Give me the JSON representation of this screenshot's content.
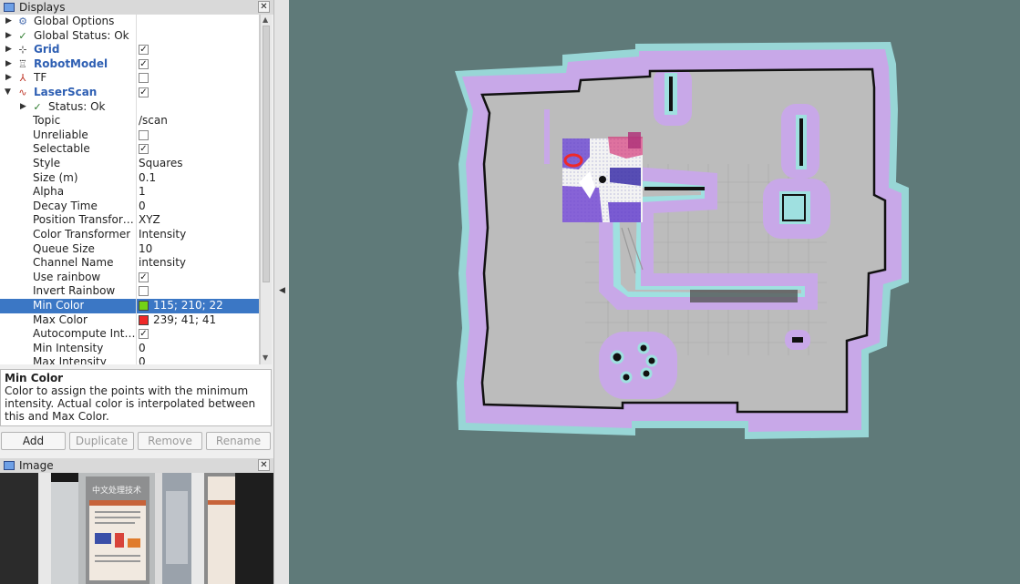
{
  "displays_panel": {
    "title": "Displays",
    "close_label": "✕",
    "rows": [
      {
        "name": "Global Options",
        "value": ""
      },
      {
        "name": "Global Status: Ok",
        "value": ""
      },
      {
        "name": "Grid",
        "value": ""
      },
      {
        "name": "RobotModel",
        "value": ""
      },
      {
        "name": "TF",
        "value": ""
      },
      {
        "name": "LaserScan",
        "value": ""
      },
      {
        "name": "Status: Ok",
        "value": ""
      },
      {
        "name": "Topic",
        "value": "/scan"
      },
      {
        "name": "Unreliable",
        "value": ""
      },
      {
        "name": "Selectable",
        "value": ""
      },
      {
        "name": "Style",
        "value": "Squares"
      },
      {
        "name": "Size (m)",
        "value": "0.1"
      },
      {
        "name": "Alpha",
        "value": "1"
      },
      {
        "name": "Decay Time",
        "value": "0"
      },
      {
        "name": "Position Transfor…",
        "value": "XYZ"
      },
      {
        "name": "Color Transformer",
        "value": "Intensity"
      },
      {
        "name": "Queue Size",
        "value": "10"
      },
      {
        "name": "Channel Name",
        "value": "intensity"
      },
      {
        "name": "Use rainbow",
        "value": ""
      },
      {
        "name": "Invert Rainbow",
        "value": ""
      },
      {
        "name": "Min Color",
        "value": "115; 210; 22"
      },
      {
        "name": "Max Color",
        "value": "239; 41; 41"
      },
      {
        "name": "Autocompute Int…",
        "value": ""
      },
      {
        "name": "Min Intensity",
        "value": "0"
      },
      {
        "name": "Max Intensity",
        "value": "0"
      }
    ],
    "checkboxes": {
      "grid": true,
      "robotmodel": true,
      "tf": false,
      "laserscan": true,
      "unreliable": false,
      "selectable": true,
      "use_rainbow": true,
      "invert_rainbow": false,
      "autocompute": true
    },
    "min_color_hex": "#73d216",
    "max_color_hex": "#ef2929"
  },
  "description": {
    "title": "Min Color",
    "text": "Color to assign the points with the minimum intensity. Actual color is interpolated between this and Max Color."
  },
  "buttons": {
    "add": "Add",
    "duplicate": "Duplicate",
    "remove": "Remove",
    "rename": "Rename"
  },
  "image_panel": {
    "title": "Image",
    "close_label": "✕",
    "poster_text": "中文处理技术"
  },
  "colors": {
    "viewport_bg": "#5f7a79",
    "map_floor": "#bcbcbc",
    "cost_inflation": "#c8a8e8",
    "cost_edge": "#9fe0e0",
    "selection": "#3b77c5"
  }
}
